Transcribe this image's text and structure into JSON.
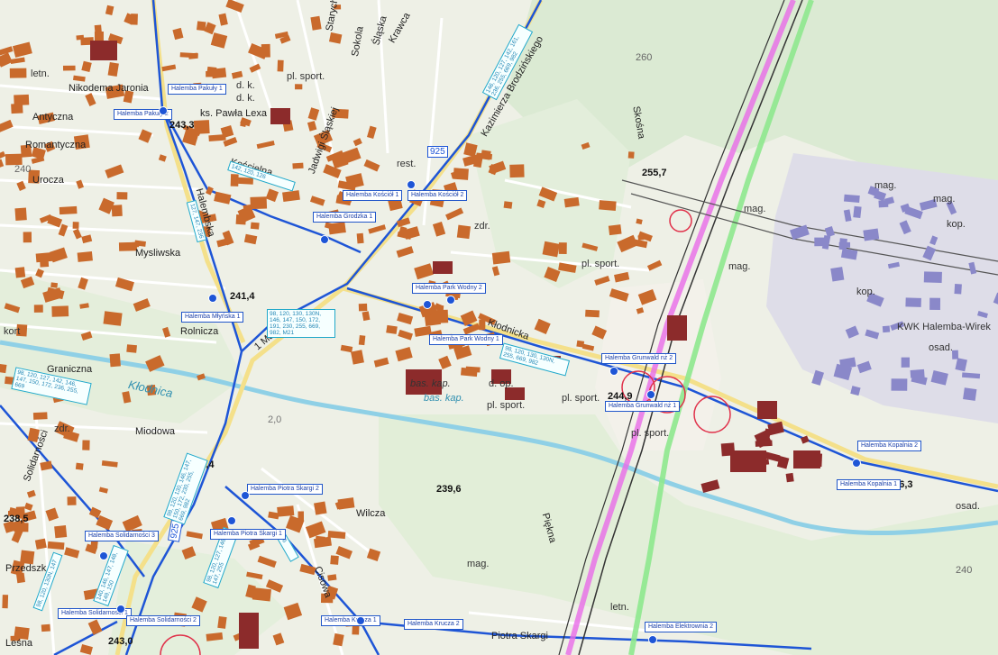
{
  "map": {
    "streets": [
      "Nikodema Jaronia",
      "Antyczna",
      "Romantyczna",
      "Urocza",
      "Mysliwska",
      "Rolnicza",
      "Graniczna",
      "Miodowa",
      "Solidarności",
      "Przedszk.",
      "Wilcza",
      "Cisowa",
      "Leśna",
      "Kłodnicka",
      "1 Maja",
      "Halembska",
      "Kościelna",
      "ks. Pawła Lexa",
      "Jadwigi Śląskiej",
      "Kazimierza Brodzińskiego",
      "Skośna",
      "Piękna",
      "Piotra Skargi",
      "Śląska",
      "Sokola",
      "Starych",
      "Krawca"
    ],
    "places": [
      "Kłodnica",
      "bas. kap.",
      "bas. kap.",
      "pl. sport.",
      "pl. sport.",
      "pl. sport.",
      "pl. sport.",
      "pl. sport.",
      "d. op.",
      "zdr.",
      "zdr.",
      "rest.",
      "mag.",
      "mag.",
      "mag.",
      "mag.",
      "mag.",
      "kop.",
      "kop.",
      "osad.",
      "osad.",
      "KWK Halemba-Wirek",
      "letn.",
      "letn.",
      "kort",
      "d. k.",
      "d. k."
    ],
    "elevations": [
      "243,3",
      "241,4",
      "241,4",
      "255,7",
      "244,9",
      "239,6",
      "238,5",
      "246,3",
      "243,0",
      "260",
      "240",
      "240",
      "2,0"
    ],
    "stops": [
      {
        "name": "Halemba Pakuły 1"
      },
      {
        "name": "Halemba Pakuły 2"
      },
      {
        "name": "Halemba Kościół 1"
      },
      {
        "name": "Halemba Kościół 2"
      },
      {
        "name": "Halemba Grodzka 1"
      },
      {
        "name": "Halemba Park Wodny 2"
      },
      {
        "name": "Halemba Park Wodny 1"
      },
      {
        "name": "Halemba Młyńska 1"
      },
      {
        "name": "Halemba Grunwald nż 2"
      },
      {
        "name": "Halemba Grunwald nż 1"
      },
      {
        "name": "Halemba Kopalnia 2"
      },
      {
        "name": "Halemba Kopalnia 1"
      },
      {
        "name": "Halemba Piotra Skargi 2"
      },
      {
        "name": "Halemba Piotra Skargi 1"
      },
      {
        "name": "Halemba Solidarności 3"
      },
      {
        "name": "Halemba Solidarności 1"
      },
      {
        "name": "Halemba Solidarności 2"
      },
      {
        "name": "Halemba Krucza 1"
      },
      {
        "name": "Halemba Krucza 2"
      },
      {
        "name": "Halemba Elektrownia 2"
      }
    ],
    "route_boxes": [
      "142, 120, 126",
      "146, 120, 127, 142, 161, 236, 255, 669, 982",
      "98, 120, 130, 130N, 146, 147, 150, 172, 191, 230, 255, 669, 982, M21",
      "98, 120, 130, 130N, 255, 669, 982",
      "98, 120, 127, 142, 146, 147, 150, 172, 236, 255, 669",
      "127, 147, 236",
      "98, 120, 130, 146, 147, 150, 172, 230, 255, 669, 982",
      "98, 120, 130N, 147",
      "140, 146, 147, 148, 149, 150",
      "146",
      "98, 120, 127, 146, 147, 255"
    ],
    "road_numbers": [
      "925",
      "925"
    ]
  }
}
